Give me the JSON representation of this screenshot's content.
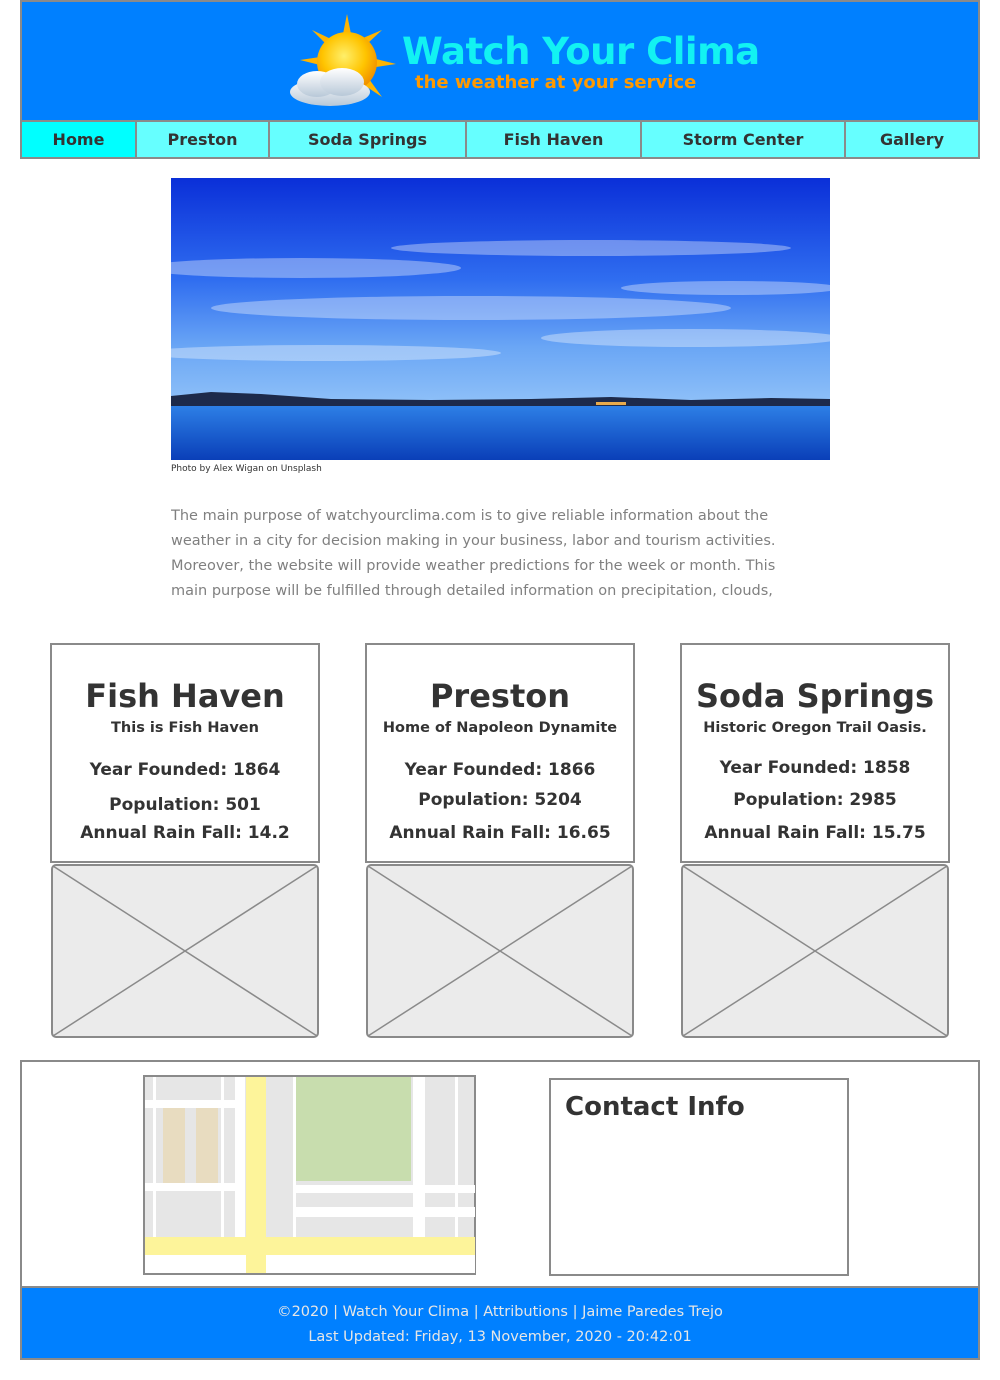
{
  "header": {
    "title": "Watch Your Clima",
    "tagline": "the weather at your service",
    "logo_icon": "sun-cloud-icon"
  },
  "nav": {
    "items": [
      "Home",
      "Preston",
      "Soda Springs",
      "Fish Haven",
      "Storm Center",
      "Gallery"
    ],
    "active": "Home"
  },
  "hero": {
    "caption": "Photo by Alex Wigan on Unsplash"
  },
  "intro": {
    "text": "The main purpose of watchyourclima.com is to give reliable information about the weather in a city for decision making in your business, labor and tourism activities. Moreover, the website will provide weather predictions for the week or month. This main purpose will be fulfilled through detailed information on precipitation, clouds,"
  },
  "towns": [
    {
      "name": "Fish Haven",
      "motto": "This is Fish Haven",
      "year": "Year Founded: 1864",
      "population": "Population: 501",
      "rain": "Annual Rain Fall: 14.2"
    },
    {
      "name": "Preston",
      "motto": "Home of Napoleon Dynamite",
      "year": "Year Founded: 1866",
      "population": "Population: 5204",
      "rain": "Annual Rain Fall: 16.65"
    },
    {
      "name": "Soda Springs",
      "motto": "Historic Oregon Trail Oasis.",
      "year": "Year Founded: 1858",
      "population": "Population: 2985",
      "rain": "Annual Rain Fall: 15.75"
    }
  ],
  "contact": {
    "title": "Contact Info"
  },
  "footer": {
    "copyright": "©2020",
    "site": "Watch Your Clima",
    "attributions": "Attributions",
    "author": "Jaime Paredes Trejo",
    "separator": "|",
    "last_updated": "Last Updated: Friday, 13 November, 2020 - 20:42:01"
  },
  "colors": {
    "header_bg": "#0080ff",
    "title": "#12f2f2",
    "tagline": "#ff9900",
    "nav_bg": "#66ffff",
    "nav_active": "#00ffff"
  }
}
